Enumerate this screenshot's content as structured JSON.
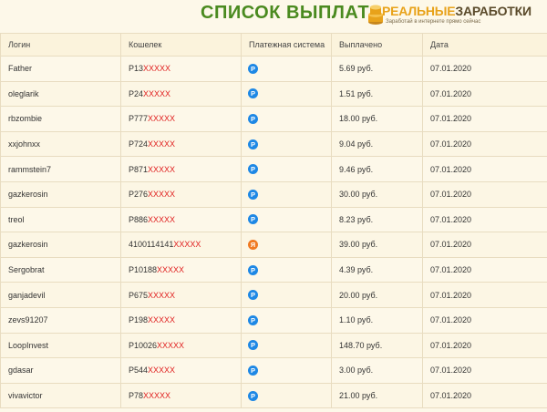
{
  "header": {
    "title": "СПИСОК ВЫПЛАТ",
    "logo_word1": "РЕАЛЬНЫЕ",
    "logo_word2": "ЗАРАБОТКИ",
    "logo_tagline": "Заработай в интернете прямо сейчас",
    "title_color": "#4a8a1f",
    "logo_accent": "#e8a21a"
  },
  "table": {
    "columns": [
      "Логин",
      "Кошелек",
      "Платежная система",
      "Выплачено",
      "Дата"
    ],
    "rows": [
      {
        "login": "Father",
        "wallet_prefix": "P13",
        "wallet_mask": "XXXXX",
        "system": "payeer-icon",
        "paid": "5.69 руб.",
        "date": "07.01.2020"
      },
      {
        "login": "oleglarik",
        "wallet_prefix": "P24",
        "wallet_mask": "XXXXX",
        "system": "payeer-icon",
        "paid": "1.51 руб.",
        "date": "07.01.2020"
      },
      {
        "login": "rbzombie",
        "wallet_prefix": "P777",
        "wallet_mask": "XXXXX",
        "system": "payeer-icon",
        "paid": "18.00 руб.",
        "date": "07.01.2020"
      },
      {
        "login": "xxjohnxx",
        "wallet_prefix": "P724",
        "wallet_mask": "XXXXX",
        "system": "payeer-icon",
        "paid": "9.04 руб.",
        "date": "07.01.2020"
      },
      {
        "login": "rammstein7",
        "wallet_prefix": "P871",
        "wallet_mask": "XXXXX",
        "system": "payeer-icon",
        "paid": "9.46 руб.",
        "date": "07.01.2020"
      },
      {
        "login": "gazkerosin",
        "wallet_prefix": "P276",
        "wallet_mask": "XXXXX",
        "system": "payeer-icon",
        "paid": "30.00 руб.",
        "date": "07.01.2020"
      },
      {
        "login": "treol",
        "wallet_prefix": "P886",
        "wallet_mask": "XXXXX",
        "system": "payeer-icon",
        "paid": "8.23 руб.",
        "date": "07.01.2020"
      },
      {
        "login": "gazkerosin",
        "wallet_prefix": "4100114141",
        "wallet_mask": "XXXXX",
        "system": "yoomoney-icon",
        "paid": "39.00 руб.",
        "date": "07.01.2020"
      },
      {
        "login": "Sergobrat",
        "wallet_prefix": "P10188",
        "wallet_mask": "XXXXX",
        "system": "payeer-icon",
        "paid": "4.39 руб.",
        "date": "07.01.2020"
      },
      {
        "login": "ganjadevil",
        "wallet_prefix": "P675",
        "wallet_mask": "XXXXX",
        "system": "payeer-icon",
        "paid": "20.00 руб.",
        "date": "07.01.2020"
      },
      {
        "login": "zevs91207",
        "wallet_prefix": "P198",
        "wallet_mask": "XXXXX",
        "system": "payeer-icon",
        "paid": "1.10 руб.",
        "date": "07.01.2020"
      },
      {
        "login": "LoopInvest",
        "wallet_prefix": "P10026",
        "wallet_mask": "XXXXX",
        "system": "payeer-icon",
        "paid": "148.70 руб.",
        "date": "07.01.2020"
      },
      {
        "login": "gdasar",
        "wallet_prefix": "P544",
        "wallet_mask": "XXXXX",
        "system": "payeer-icon",
        "paid": "3.00 руб.",
        "date": "07.01.2020"
      },
      {
        "login": "vivavictor",
        "wallet_prefix": "P78",
        "wallet_mask": "XXXXX",
        "system": "payeer-icon",
        "paid": "21.00 руб.",
        "date": "07.01.2020"
      }
    ]
  },
  "icons": {
    "payeer": {
      "glyph": "P",
      "color": "#1e88e5"
    },
    "yoomoney": {
      "glyph": "Я",
      "color": "#f07a22"
    }
  }
}
